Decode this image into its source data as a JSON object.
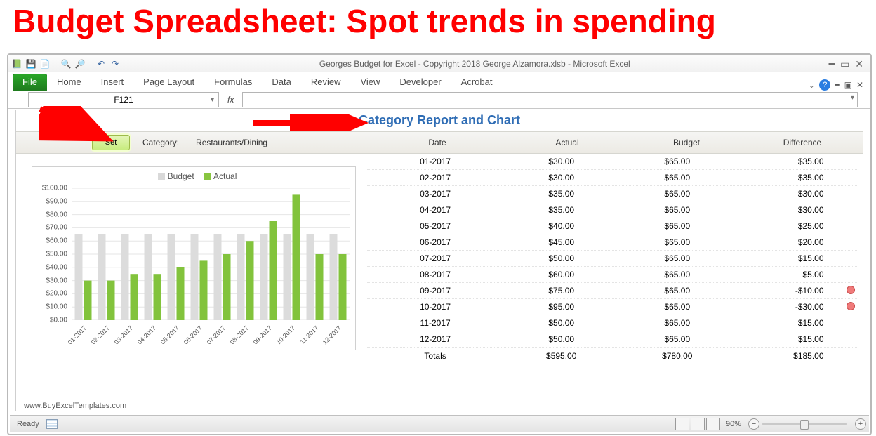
{
  "headline": "Budget Spreadsheet: Spot trends in spending",
  "title": "Georges Budget for Excel - Copyright 2018 George Alzamora.xlsb  -  Microsoft Excel",
  "ribbon_tabs": [
    "File",
    "Home",
    "Insert",
    "Page Layout",
    "Formulas",
    "Data",
    "Review",
    "View",
    "Developer",
    "Acrobat"
  ],
  "namebox": "F121",
  "fx_label": "fx",
  "doc_title": "Category Report and Chart",
  "set_button": "Set",
  "category_label": "Category:",
  "category_value": "Restaurants/Dining",
  "columns": {
    "date": "Date",
    "actual": "Actual",
    "budget": "Budget",
    "difference": "Difference"
  },
  "rows": [
    {
      "date": "01-2017",
      "actual": "$30.00",
      "budget": "$65.00",
      "diff": "$35.00",
      "flag": false
    },
    {
      "date": "02-2017",
      "actual": "$30.00",
      "budget": "$65.00",
      "diff": "$35.00",
      "flag": false
    },
    {
      "date": "03-2017",
      "actual": "$35.00",
      "budget": "$65.00",
      "diff": "$30.00",
      "flag": false
    },
    {
      "date": "04-2017",
      "actual": "$35.00",
      "budget": "$65.00",
      "diff": "$30.00",
      "flag": false
    },
    {
      "date": "05-2017",
      "actual": "$40.00",
      "budget": "$65.00",
      "diff": "$25.00",
      "flag": false
    },
    {
      "date": "06-2017",
      "actual": "$45.00",
      "budget": "$65.00",
      "diff": "$20.00",
      "flag": false
    },
    {
      "date": "07-2017",
      "actual": "$50.00",
      "budget": "$65.00",
      "diff": "$15.00",
      "flag": false
    },
    {
      "date": "08-2017",
      "actual": "$60.00",
      "budget": "$65.00",
      "diff": "$5.00",
      "flag": false
    },
    {
      "date": "09-2017",
      "actual": "$75.00",
      "budget": "$65.00",
      "diff": "-$10.00",
      "flag": true
    },
    {
      "date": "10-2017",
      "actual": "$95.00",
      "budget": "$65.00",
      "diff": "-$30.00",
      "flag": true
    },
    {
      "date": "11-2017",
      "actual": "$50.00",
      "budget": "$65.00",
      "diff": "$15.00",
      "flag": false
    },
    {
      "date": "12-2017",
      "actual": "$50.00",
      "budget": "$65.00",
      "diff": "$15.00",
      "flag": false
    }
  ],
  "totals": {
    "label": "Totals",
    "actual": "$595.00",
    "budget": "$780.00",
    "diff": "$185.00"
  },
  "legend": {
    "budget": "Budget",
    "actual": "Actual"
  },
  "y_ticks": [
    "$100.00",
    "$90.00",
    "$80.00",
    "$70.00",
    "$60.00",
    "$50.00",
    "$40.00",
    "$30.00",
    "$20.00",
    "$10.00",
    "$0.00"
  ],
  "footer": "www.BuyExcelTemplates.com",
  "status": {
    "ready": "Ready",
    "zoom": "90%"
  },
  "chart_data": {
    "type": "bar",
    "title": "",
    "xlabel": "",
    "ylabel": "",
    "ylim": [
      0,
      100
    ],
    "categories": [
      "01-2017",
      "02-2017",
      "03-2017",
      "04-2017",
      "05-2017",
      "06-2017",
      "07-2017",
      "08-2017",
      "09-2017",
      "10-2017",
      "11-2017",
      "12-2017"
    ],
    "series": [
      {
        "name": "Budget",
        "values": [
          65,
          65,
          65,
          65,
          65,
          65,
          65,
          65,
          65,
          65,
          65,
          65
        ]
      },
      {
        "name": "Actual",
        "values": [
          30,
          30,
          35,
          35,
          40,
          45,
          50,
          60,
          75,
          95,
          50,
          50
        ]
      }
    ]
  }
}
